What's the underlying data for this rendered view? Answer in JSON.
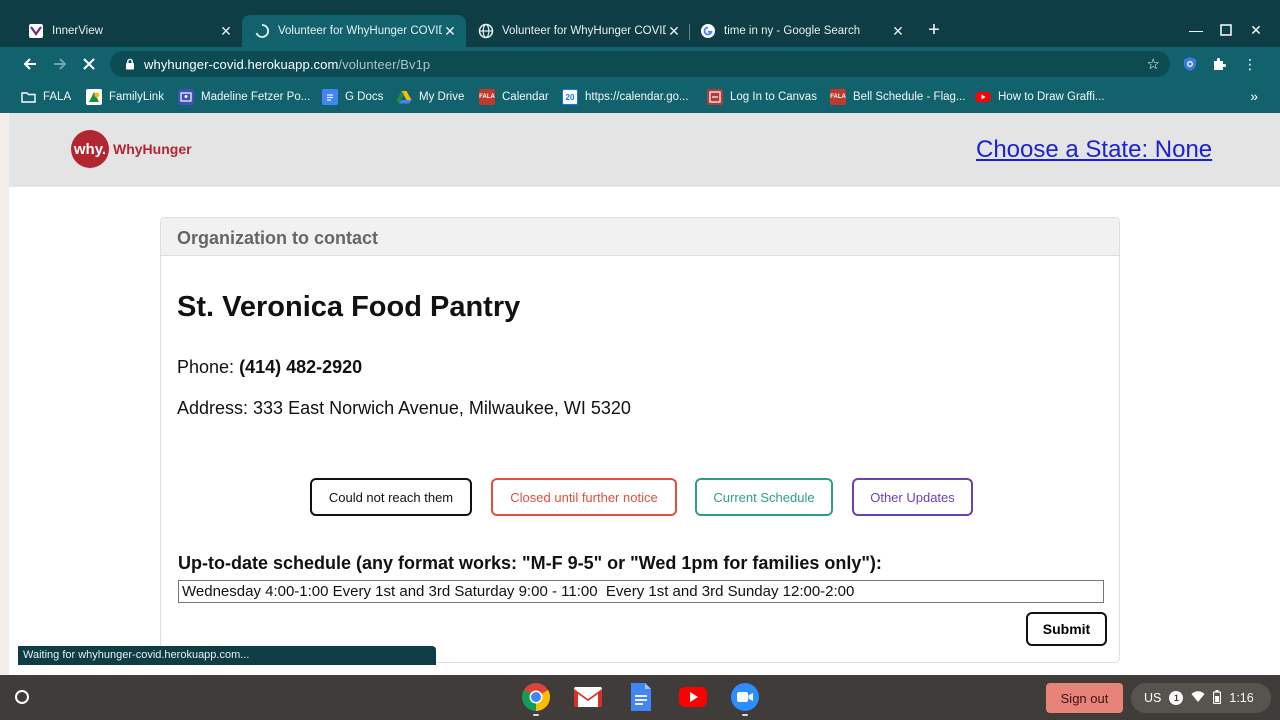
{
  "tabs": [
    {
      "title": "InnerView",
      "favicon": "innerview-icon",
      "active": false
    },
    {
      "title": "Volunteer for WhyHunger COVID",
      "favicon": "loading-spinner-icon",
      "active": true
    },
    {
      "title": "Volunteer for WhyHunger COVID",
      "favicon": "globe-icon",
      "active": false
    },
    {
      "title": "time in ny - Google Search",
      "favicon": "google-icon",
      "active": false
    }
  ],
  "address_bar": {
    "host": "whyhunger-covid.herokuapp.com",
    "path": "/volunteer/Bv1p"
  },
  "bookmarks": [
    {
      "label": "FALA",
      "icon": "folder-icon"
    },
    {
      "label": "FamilyLink",
      "icon": "familylink-icon"
    },
    {
      "label": "Madeline Fetzer Po...",
      "icon": "classroom-icon"
    },
    {
      "label": "G Docs",
      "icon": "docs-icon"
    },
    {
      "label": "My Drive",
      "icon": "drive-icon"
    },
    {
      "label": "Calendar",
      "icon": "calendar-icon"
    },
    {
      "label": "https://calendar.go...",
      "icon": "google-calendar-icon"
    },
    {
      "label": "Log In to Canvas",
      "icon": "canvas-icon"
    },
    {
      "label": "Bell Schedule - Flag...",
      "icon": "school-icon"
    },
    {
      "label": "How to Draw Graffi...",
      "icon": "youtube-icon"
    }
  ],
  "site": {
    "logo_mark": "why.",
    "logo_text": "WhyHunger",
    "choose_state": "Choose a State: None"
  },
  "card": {
    "header": "Organization to contact",
    "org_name": "St. Veronica Food Pantry",
    "phone_label": "Phone:",
    "phone": "(414) 482-2920",
    "address": "Address: 333 East Norwich Avenue, Milwaukee, WI 5320",
    "outcome_buttons": [
      {
        "label": "Could not reach them",
        "color": "#111111"
      },
      {
        "label": "Closed until further notice",
        "color": "#e0503f"
      },
      {
        "label": "Current Schedule",
        "color": "#2e9e84"
      },
      {
        "label": "Other Updates",
        "color": "#6c3fb5"
      }
    ],
    "schedule_label": "Up-to-date schedule (any format works: \"M-F 9-5\" or \"Wed 1pm for families only\"):",
    "schedule_value": "Wednesday 4:00-1:00 Every 1st and 3rd Saturday 9:00 - 11:00  Every 1st and 3rd Sunday 12:00-2:00",
    "submit_label": "Submit"
  },
  "status_text": "Waiting for whyhunger-covid.herokuapp.com...",
  "shelf": {
    "apps": [
      "chrome-icon",
      "gmail-icon",
      "docs-icon",
      "youtube-icon",
      "zoom-icon"
    ],
    "sign_out": "Sign out",
    "locale": "US",
    "notification_count": "1",
    "time": "1:16"
  }
}
